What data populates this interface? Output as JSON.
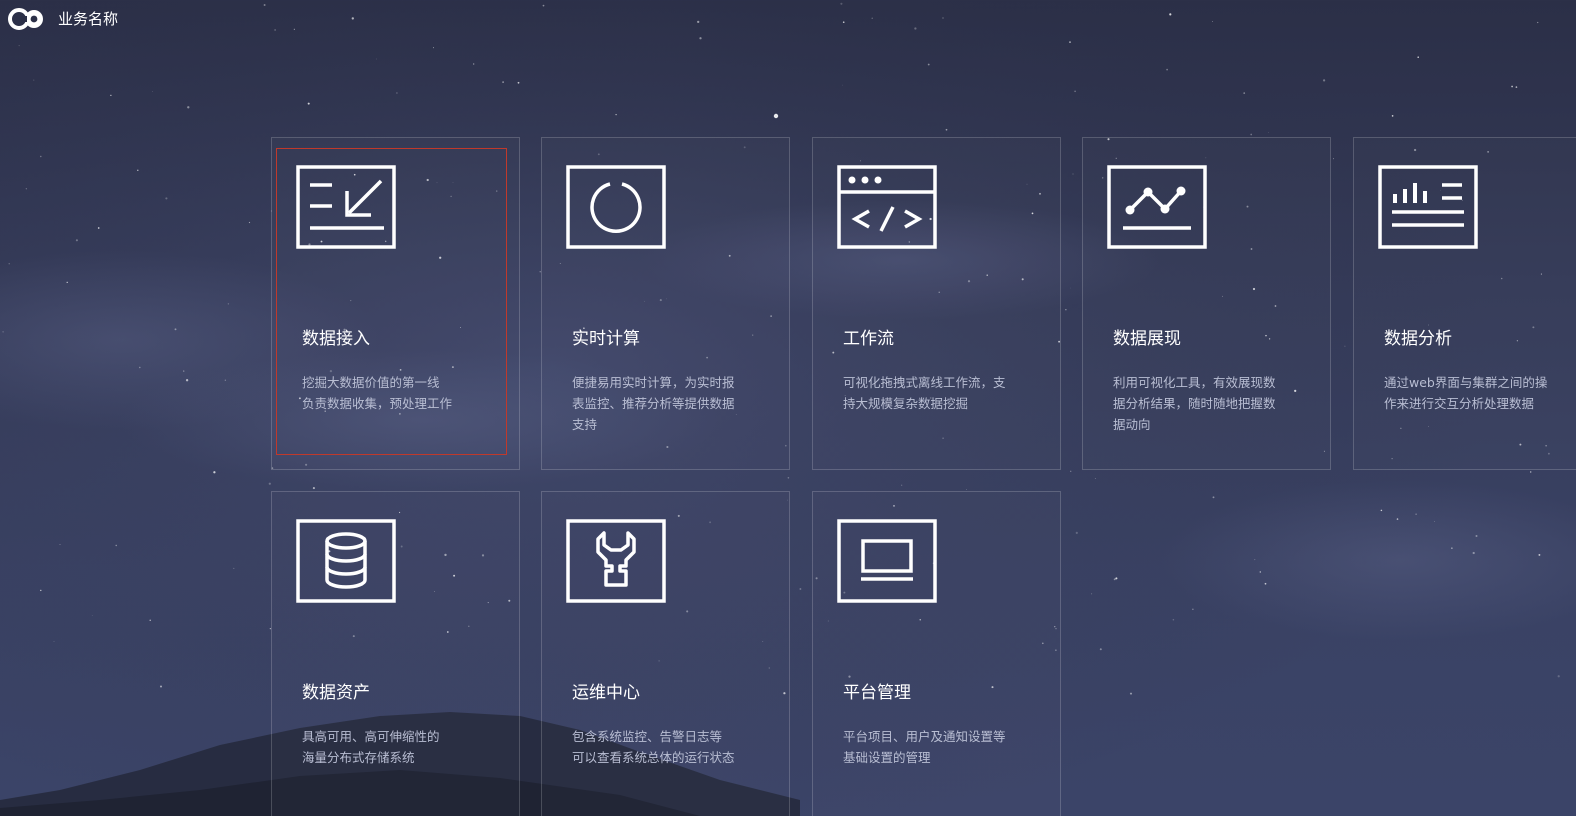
{
  "header": {
    "app_title": "业务名称"
  },
  "colors": {
    "bg_top": "#2b2f47",
    "bg_bottom": "#3b4468",
    "card_border": "rgba(255,255,255,0.18)",
    "focus_border": "#c0392b",
    "title_color": "#ffffff",
    "desc_color": "#b9bed3"
  },
  "cards": [
    {
      "icon": "data-import-icon",
      "title": "数据接入",
      "desc": [
        "挖掘大数据价值的第一线",
        "负责数据收集，预处理工作"
      ],
      "selected": true
    },
    {
      "icon": "realtime-compute-icon",
      "title": "实时计算",
      "desc": [
        "便捷易用实时计算，为实时报",
        "表监控、推荐分析等提供数据",
        "支持"
      ]
    },
    {
      "icon": "code-window-icon",
      "title": "工作流",
      "desc": [
        "可视化拖拽式离线工作流，支",
        "持大规模复杂数据挖掘"
      ]
    },
    {
      "icon": "line-chart-icon",
      "title": "数据展现",
      "desc": [
        "利用可视化工具，有效展现数",
        "据分析结果，随时随地把握数",
        "据动向"
      ]
    },
    {
      "icon": "bar-report-icon",
      "title": "数据分析",
      "desc": [
        "通过web界面与集群之间的操",
        "作来进行交互分析处理数据"
      ]
    },
    {
      "icon": "database-icon",
      "title": "数据资产",
      "desc": [
        "具高可用、高可伸缩性的",
        "海量分布式存储系统"
      ]
    },
    {
      "icon": "wrench-icon",
      "title": "运维中心",
      "desc": [
        "包含系统监控、告警日志等",
        "可以查看系统总体的运行状态"
      ]
    },
    {
      "icon": "monitor-icon",
      "title": "平台管理",
      "desc": [
        "平台项目、用户及通知设置等",
        "基础设置的管理"
      ]
    }
  ]
}
